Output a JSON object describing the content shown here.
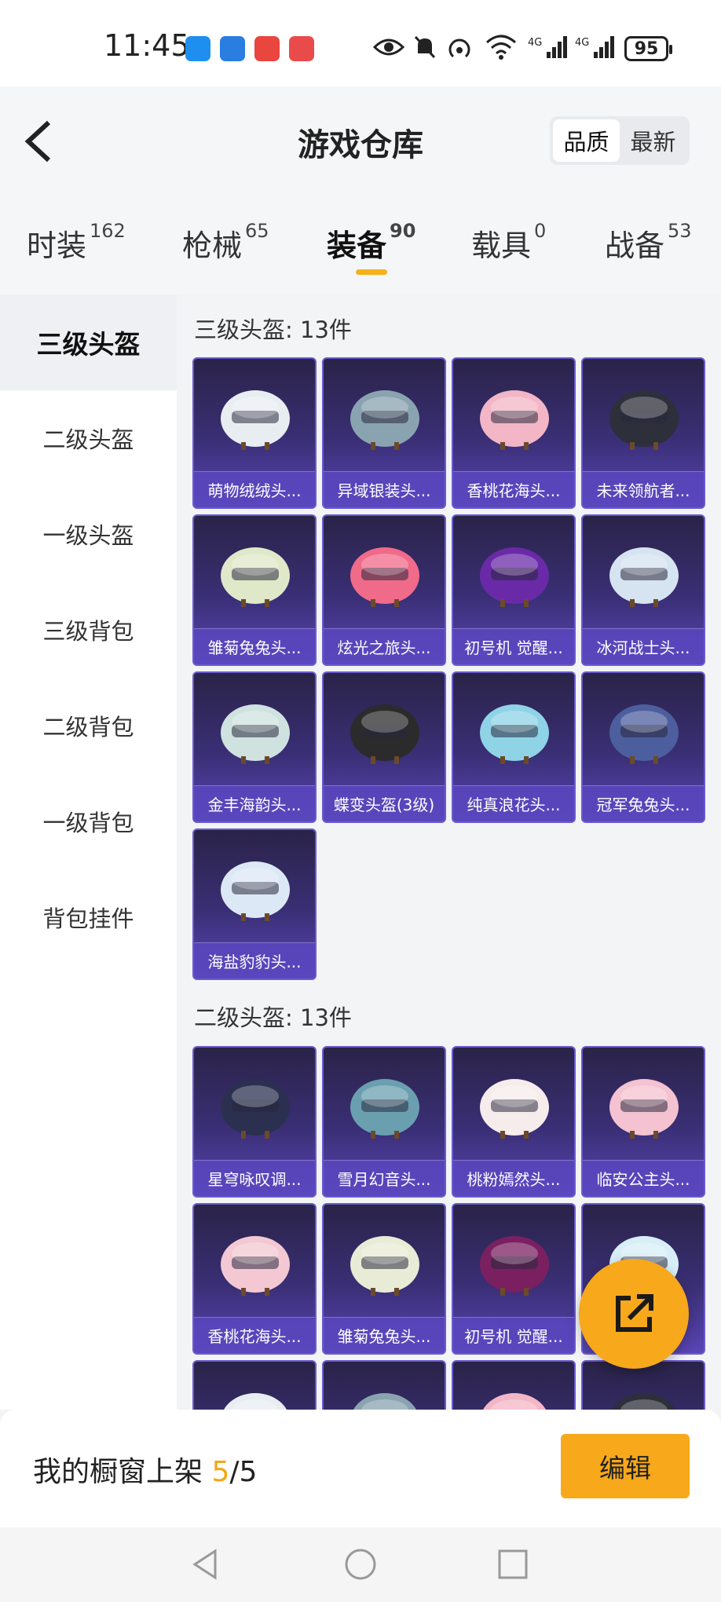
{
  "status_bar": {
    "time": "11:45",
    "notification_icons": [
      "chat-app-icon",
      "messenger-app-icon",
      "huawei-app-icon",
      "reader-app-icon"
    ],
    "system_icons": [
      "eye-icon",
      "mute-bell-icon",
      "hotspot-icon",
      "wifi-icon",
      "signal-4g-icon",
      "signal-4g-icon"
    ],
    "battery": "95"
  },
  "header": {
    "title": "游戏仓库",
    "sort_options": [
      "品质",
      "最新"
    ],
    "sort_selected": "品质"
  },
  "tabs": [
    {
      "label": "时装",
      "count": "162",
      "active": false
    },
    {
      "label": "枪械",
      "count": "65",
      "active": false
    },
    {
      "label": "装备",
      "count": "90",
      "active": true
    },
    {
      "label": "载具",
      "count": "0",
      "active": false
    },
    {
      "label": "战备",
      "count": "53",
      "active": false
    }
  ],
  "sidebar": {
    "items": [
      {
        "label": "三级头盔",
        "active": true
      },
      {
        "label": "二级头盔",
        "active": false
      },
      {
        "label": "一级头盔",
        "active": false
      },
      {
        "label": "三级背包",
        "active": false
      },
      {
        "label": "二级背包",
        "active": false
      },
      {
        "label": "一级背包",
        "active": false
      },
      {
        "label": "背包挂件",
        "active": false
      }
    ]
  },
  "sections": [
    {
      "title": "三级头盔: 13件",
      "items": [
        "萌物绒绒头...",
        "异域银装头...",
        "香桃花海头...",
        "未来领航者...",
        "雏菊兔兔头...",
        "炫光之旅头...",
        "初号机 觉醒...",
        "冰河战士头...",
        "金丰海韵头...",
        "蝶变头盔(3级)",
        "纯真浪花头...",
        "冠军兔兔头...",
        "海盐豹豹头..."
      ]
    },
    {
      "title": "二级头盔: 13件",
      "items": [
        "星穹咏叹调...",
        "雪月幻音头...",
        "桃粉嫣然头...",
        "临安公主头...",
        "香桃花海头...",
        "雏菊兔兔头...",
        "初号机 觉醒...",
        "..."
      ]
    }
  ],
  "bottom": {
    "showcase_label": "我的橱窗上架",
    "showcase_current": "5",
    "showcase_total": "/5",
    "edit_label": "编辑"
  },
  "colors": {
    "accent": "#f7a81b",
    "card_top": "#2a2348",
    "card_bottom": "#5a45b6"
  }
}
